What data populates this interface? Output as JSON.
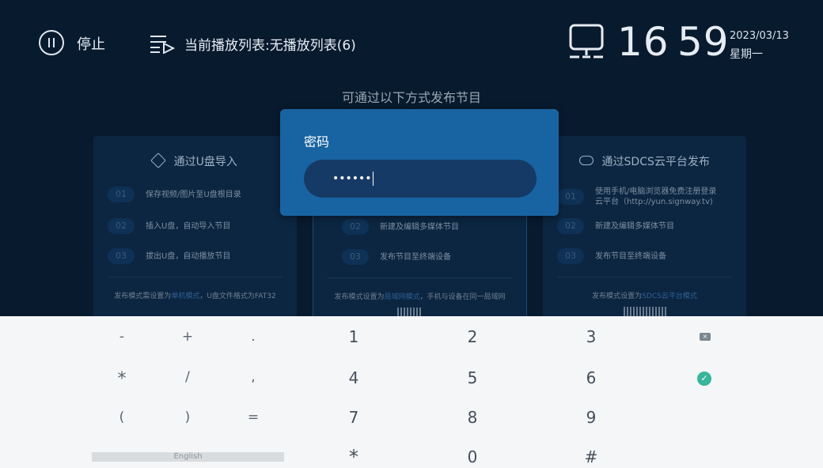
{
  "topbar": {
    "stop_label": "停止",
    "playlist_label": "当前播放列表:无播放列表(6)",
    "clock_hour": "16",
    "clock_minute": "59",
    "date": "2023/03/13",
    "weekday": "星期一"
  },
  "publish": {
    "title": "可通过以下方式发布节目",
    "cards": [
      {
        "title": "通过U盘导入",
        "steps": [
          {
            "num": "01",
            "text": "保存视频/图片至U盘根目录"
          },
          {
            "num": "02",
            "text": "插入U盘，自动导入节目"
          },
          {
            "num": "03",
            "text": "拔出U盘，自动播放节目"
          }
        ],
        "foot_prefix": "发布模式需设置为",
        "foot_highlight": "单机模式",
        "foot_suffix": "，U盘文件格式为FAT32"
      },
      {
        "steps": [
          {
            "num": "02",
            "text": "新建及编辑多媒体节目"
          },
          {
            "num": "03",
            "text": "发布节目至终端设备"
          }
        ],
        "foot_prefix": "发布模式设置为",
        "foot_highlight": "局域网模式",
        "foot_suffix": "，手机与设备在同一局域网"
      },
      {
        "title": "通过SDCS云平台发布",
        "steps": [
          {
            "num": "01",
            "text": "使用手机/电脑浏览器免费注册登录",
            "text2": "云平台（http://yun.signway.tv)"
          },
          {
            "num": "02",
            "text": "新建及编辑多媒体节目"
          },
          {
            "num": "03",
            "text": "发布节目至终端设备"
          }
        ],
        "foot_prefix": "发布模式设置为",
        "foot_highlight": "SDCS云平台模式",
        "foot_suffix": ""
      }
    ]
  },
  "dialog": {
    "title": "密码",
    "password_value": "••••••"
  },
  "keyboard": {
    "row1": [
      "-",
      "+",
      ".",
      "1",
      "2",
      "3"
    ],
    "row2": [
      "*",
      "/",
      ",",
      "4",
      "5",
      "6"
    ],
    "row3": [
      "(",
      ")",
      "=",
      "7",
      "8",
      "9"
    ],
    "row4": [
      "*",
      "0",
      "#"
    ],
    "language": "English",
    "backspace_icon": "backspace-icon",
    "confirm_icon": "check-circle-icon"
  },
  "colors": {
    "dialog": "#1864a2",
    "field": "#163a66",
    "confirm": "#38b59a",
    "background": "#081a2e"
  }
}
